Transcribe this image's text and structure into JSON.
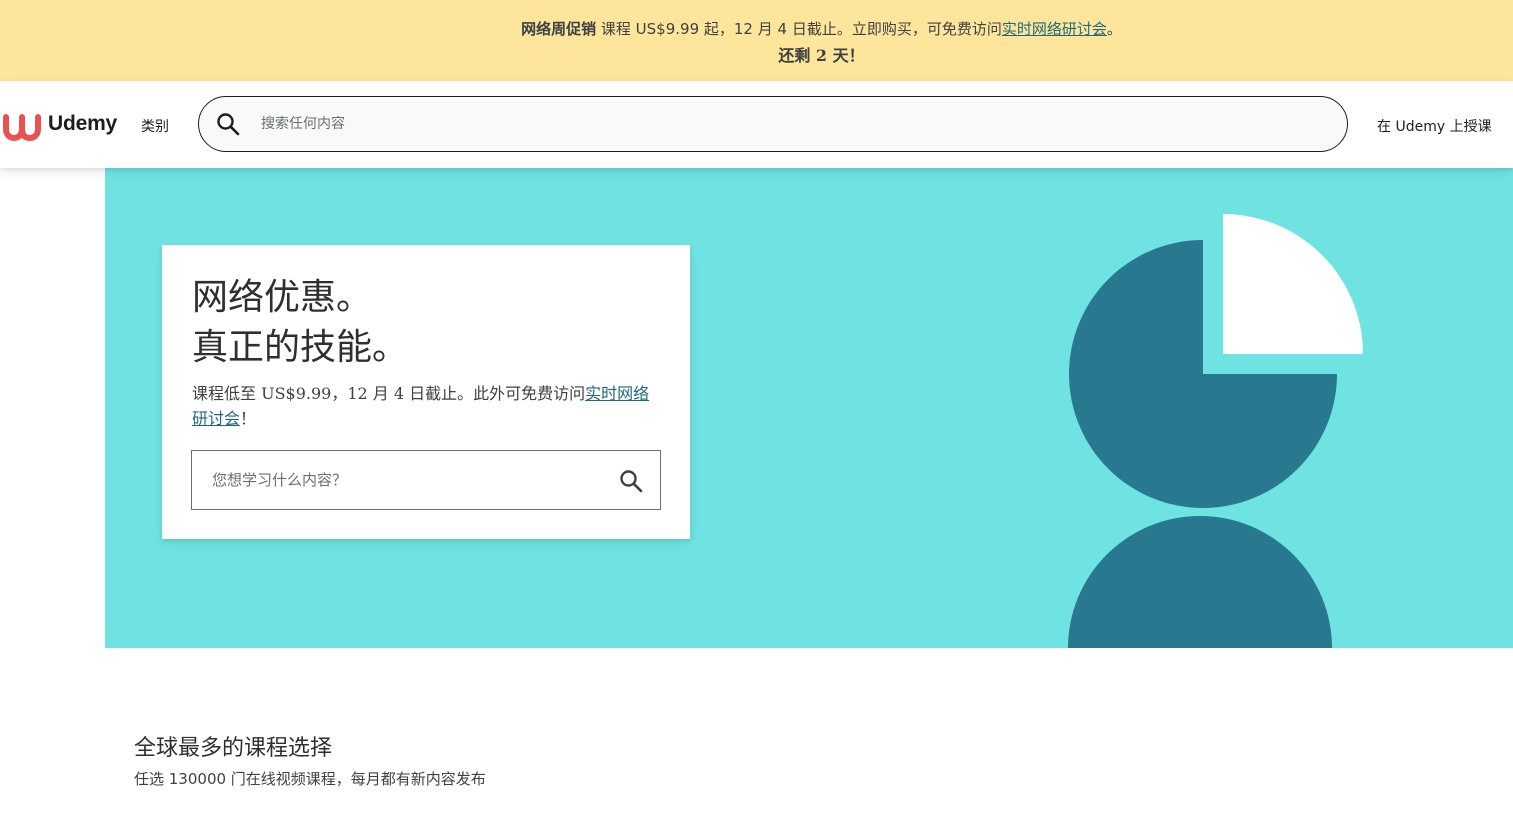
{
  "promo": {
    "bold_label": "网络周促销",
    "text": " 课程 US$9.99 起，12 月 4 日截止。立即购买，可免费访问",
    "link": "实时网络研讨会",
    "suffix": "。",
    "countdown": "还剩 2 天！"
  },
  "header": {
    "logo_text": "Udemy",
    "categories_label": "类别",
    "search_placeholder": "搜索任何内容",
    "teach_label": "在 Udemy 上授课"
  },
  "hero": {
    "title_line1": "网络优惠。",
    "title_line2": "真正的技能。",
    "desc_text": "课程低至 US$9.99，12 月 4 日截止。此外可免费访问",
    "desc_link": "实时网络研讨会",
    "desc_suffix": "！",
    "search_placeholder": "您想学习什么内容？"
  },
  "section": {
    "title": "全球最多的课程选择",
    "subtitle": "任选 130000 门在线视频课程，每月都有新内容发布"
  },
  "colors": {
    "promo_bg": "#fde69b",
    "hero_bg": "#6fe3e2",
    "hero_shape": "#287890",
    "brand_red": "#ea5252",
    "link": "#1f6a7a"
  },
  "icons": {
    "logo": "udemy-logo-icon",
    "search": "search-icon"
  }
}
